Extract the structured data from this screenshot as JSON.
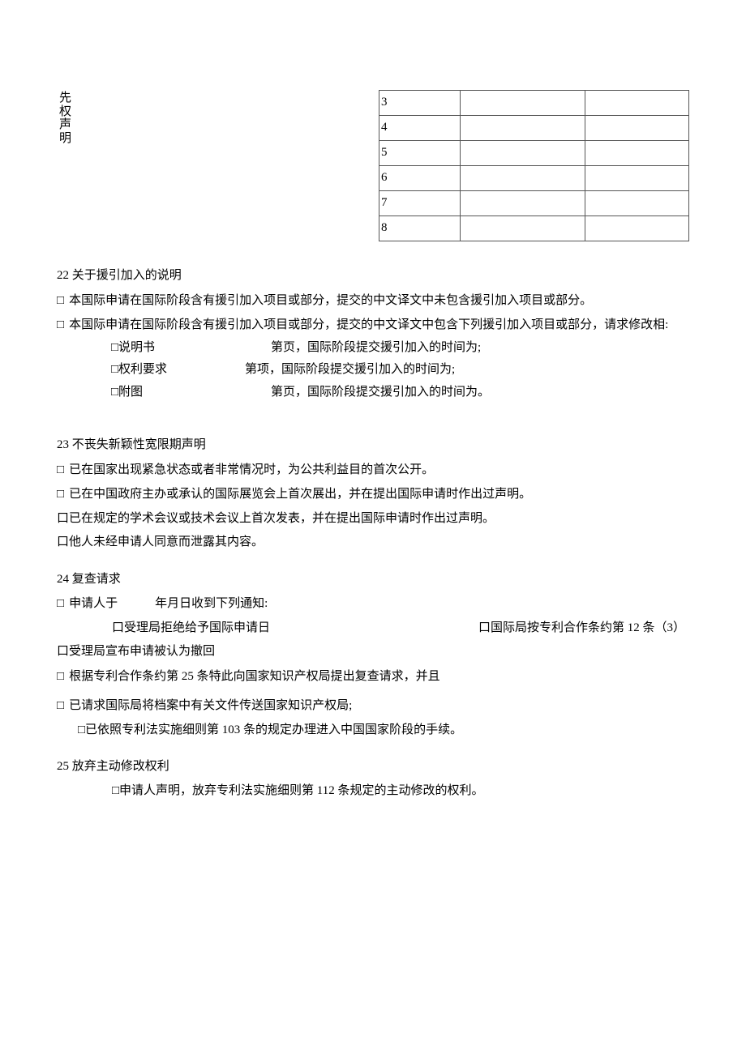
{
  "header": {
    "vertical_label": "先权声明"
  },
  "priority_rows": [
    "3",
    "4",
    "5",
    "6",
    "7",
    "8"
  ],
  "s22": {
    "title": "22 关于援引加入的说明",
    "line1": "本国际申请在国际阶段含有援引加入项目或部分，提交的中文译文中未包含援引加入项目或部分。",
    "line2": "本国际申请在国际阶段含有援引加入项目或部分，提交的中文译文中包含下列援引加入项目或部分，请求修改相:",
    "sub1_left": "□说明书",
    "sub1_right": "第页，国际阶段提交援引加入的时间为;",
    "sub2_left": "□权利要求",
    "sub2_right": "第项，国际阶段提交援引加入的时间为;",
    "sub3_left": "□附图",
    "sub3_right": "第页，国际阶段提交援引加入的时间为。"
  },
  "s23": {
    "title": "23 不丧失新颖性宽限期声明",
    "l1": "已在国家出现紧急状态或者非常情况时，为公共利益目的首次公开。",
    "l2": "已在中国政府主办或承认的国际展览会上首次展出，并在提出国际申请时作出过声明。",
    "l3": "口已在规定的学术会议或技术会议上首次发表，并在提出国际申请时作出过声明。",
    "l4": "口他人未经申请人同意而泄露其内容。"
  },
  "s24": {
    "title": "24 复查请求",
    "l1_pre": "申请人于",
    "l1_post": "年月日收到下列通知:",
    "notice_left": "口受理局拒绝给予国际申请日",
    "notice_right": "口国际局按专利合作条约第 12 条（3）",
    "l3": "口受理局宣布申请被认为撤回",
    "l4": "根据专利合作条约第 25 条特此向国家知识产权局提出复查请求，并且",
    "l5": "已请求国际局将档案中有关文件传送国家知识产权局;",
    "l6": "□已依照专利法实施细则第 103 条的规定办理进入中国国家阶段的手续。"
  },
  "s25": {
    "title": "25 放弃主动修改权利",
    "l1": "□申请人声明，放弃专利法实施细则第 112 条规定的主动修改的权利。"
  },
  "cb_glyph": "□"
}
